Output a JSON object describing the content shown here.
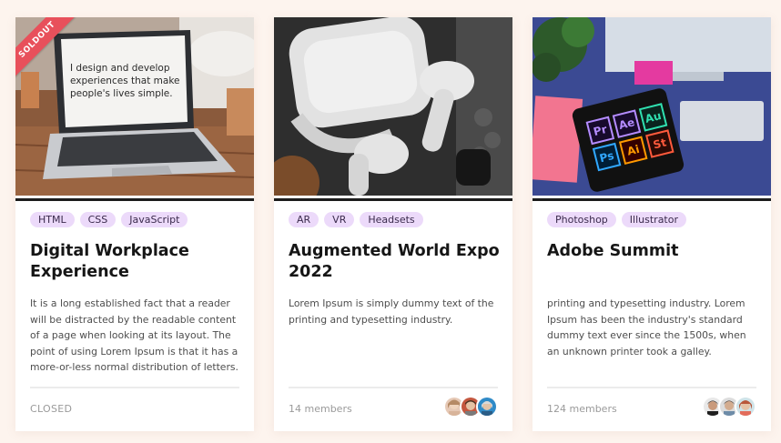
{
  "cards": [
    {
      "ribbon": "SOLDOUT",
      "image_icon": "laptop-photo",
      "laptop_screen": {
        "line1": "I design and develop",
        "line2": "experiences that make",
        "line3": "people's lives simple."
      },
      "tags": [
        "HTML",
        "CSS",
        "JavaScript"
      ],
      "title": "Digital Workplace Experience",
      "text": "It is a long established fact that a reader will be distracted by the readable content of a page when looking at its layout. The point of using Lorem Ipsum is that it has a more-or-less normal distribution of letters.",
      "footer": "CLOSED"
    },
    {
      "image_icon": "vr-headset-photo",
      "tags": [
        "AR",
        "VR",
        "Headsets"
      ],
      "title": "Augmented World Expo 2022",
      "text": "Lorem Ipsum is simply dummy text of the printing and typesetting industry.",
      "footer": "14 members"
    },
    {
      "image_icon": "adobe-tablet-photo",
      "adobe_apps": [
        "Pr",
        "Ae",
        "Au",
        "Ps",
        "Ai",
        "St"
      ],
      "tags": [
        "Photoshop",
        "Illustrator"
      ],
      "title": "Adobe Summit",
      "text": "printing and typesetting industry. Lorem Ipsum has been the industry's standard dummy text ever since the 1500s, when an unknown printer took a galley.",
      "footer": "124 members"
    }
  ],
  "colors": {
    "background": "#fdf4ee",
    "tag_bg": "#ecdafa",
    "ribbon": "#e8505b"
  }
}
